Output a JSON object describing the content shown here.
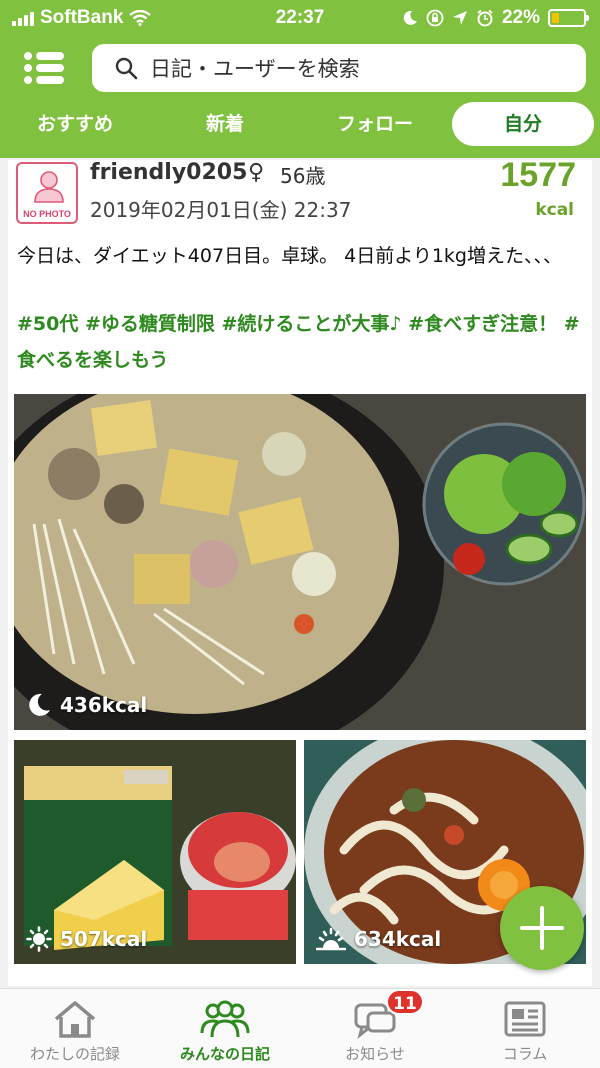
{
  "status_bar": {
    "carrier": "SoftBank",
    "time": "22:37",
    "battery": "22%",
    "battery_level": 0.22
  },
  "header": {
    "search_placeholder": "日記・ユーザーを検索",
    "tabs": [
      {
        "label": "おすすめ",
        "active": false
      },
      {
        "label": "新着",
        "active": false
      },
      {
        "label": "フォロー",
        "active": false
      },
      {
        "label": "自分",
        "active": true
      }
    ]
  },
  "post": {
    "avatar_text": "NO PHOTO",
    "username": "friendly0205",
    "gender_symbol": "♀",
    "age": "56歳",
    "date": "2019年02月01日(金) 22:37",
    "total_kcal": "1577",
    "kcal_unit": "kcal",
    "body": "今日は、ダイエット407日目。卓球。 4日前より1kg増えた、、、",
    "hashtags": "#50代 #ゆる糖質制限 #続けることが大事♪ #食べすぎ注意！ #食べるを楽しもう",
    "photos": [
      {
        "meal_icon": "moon-icon",
        "kcal": "436kcal"
      },
      {
        "meal_icon": "sun-icon",
        "kcal": "507kcal"
      },
      {
        "meal_icon": "sunrise-icon",
        "kcal": "634kcal"
      }
    ]
  },
  "bottom_nav": [
    {
      "label": "わたしの記録",
      "icon": "home-icon",
      "active": false
    },
    {
      "label": "みんなの日記",
      "icon": "people-icon",
      "active": true
    },
    {
      "label": "お知らせ",
      "icon": "chat-icon",
      "active": false,
      "badge": "11"
    },
    {
      "label": "コラム",
      "icon": "newspaper-icon",
      "active": false
    }
  ],
  "colors": {
    "brand_green": "#80c13f",
    "kcal_green": "#6aa329",
    "hashtag_green": "#2e8a1f",
    "badge_red": "#e0322c"
  }
}
